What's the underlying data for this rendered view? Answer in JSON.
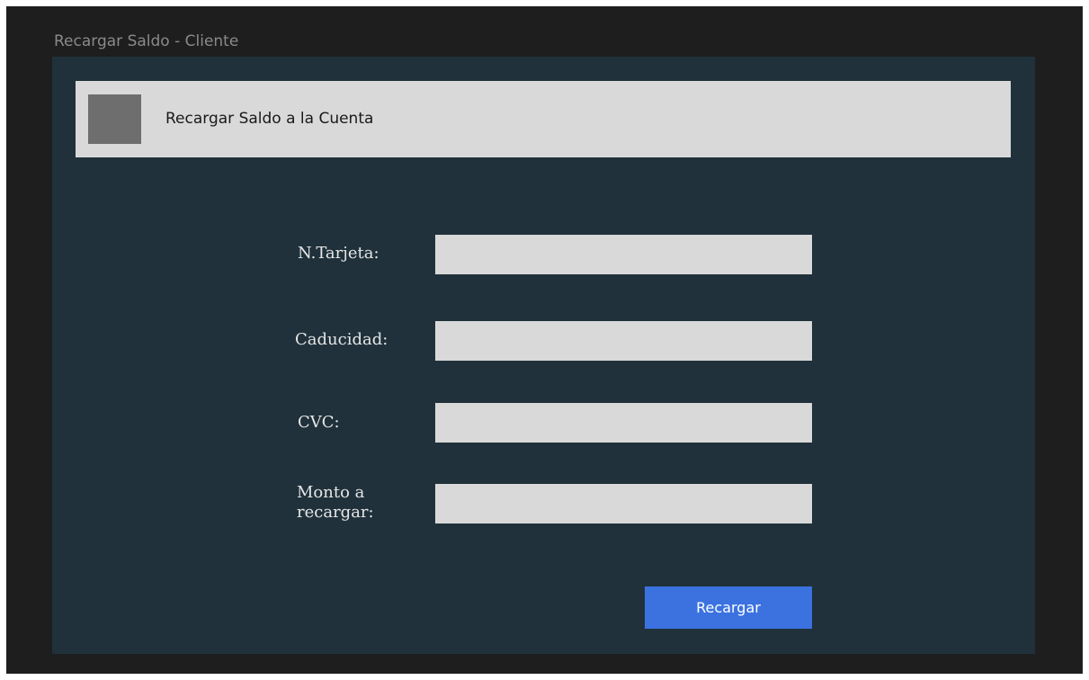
{
  "window": {
    "title": "Recargar Saldo - Cliente"
  },
  "header": {
    "title": "Recargar Saldo a la Cuenta"
  },
  "form": {
    "card_number_label": "N.Tarjeta:",
    "card_number_value": "",
    "expiry_label": "Caducidad:",
    "expiry_value": "",
    "cvc_label": "CVC:",
    "cvc_value": "",
    "amount_label_line1": "Monto a",
    "amount_label_line2": "recargar:",
    "amount_value": "",
    "submit_label": "Recargar"
  },
  "colors": {
    "canvas_background": "#1e1e1e",
    "frame_background": "#20313b",
    "header_background": "#d9d9d9",
    "logo_placeholder": "#6e6e6e",
    "input_background": "#d9d9d9",
    "button_background": "#3b72e0"
  }
}
